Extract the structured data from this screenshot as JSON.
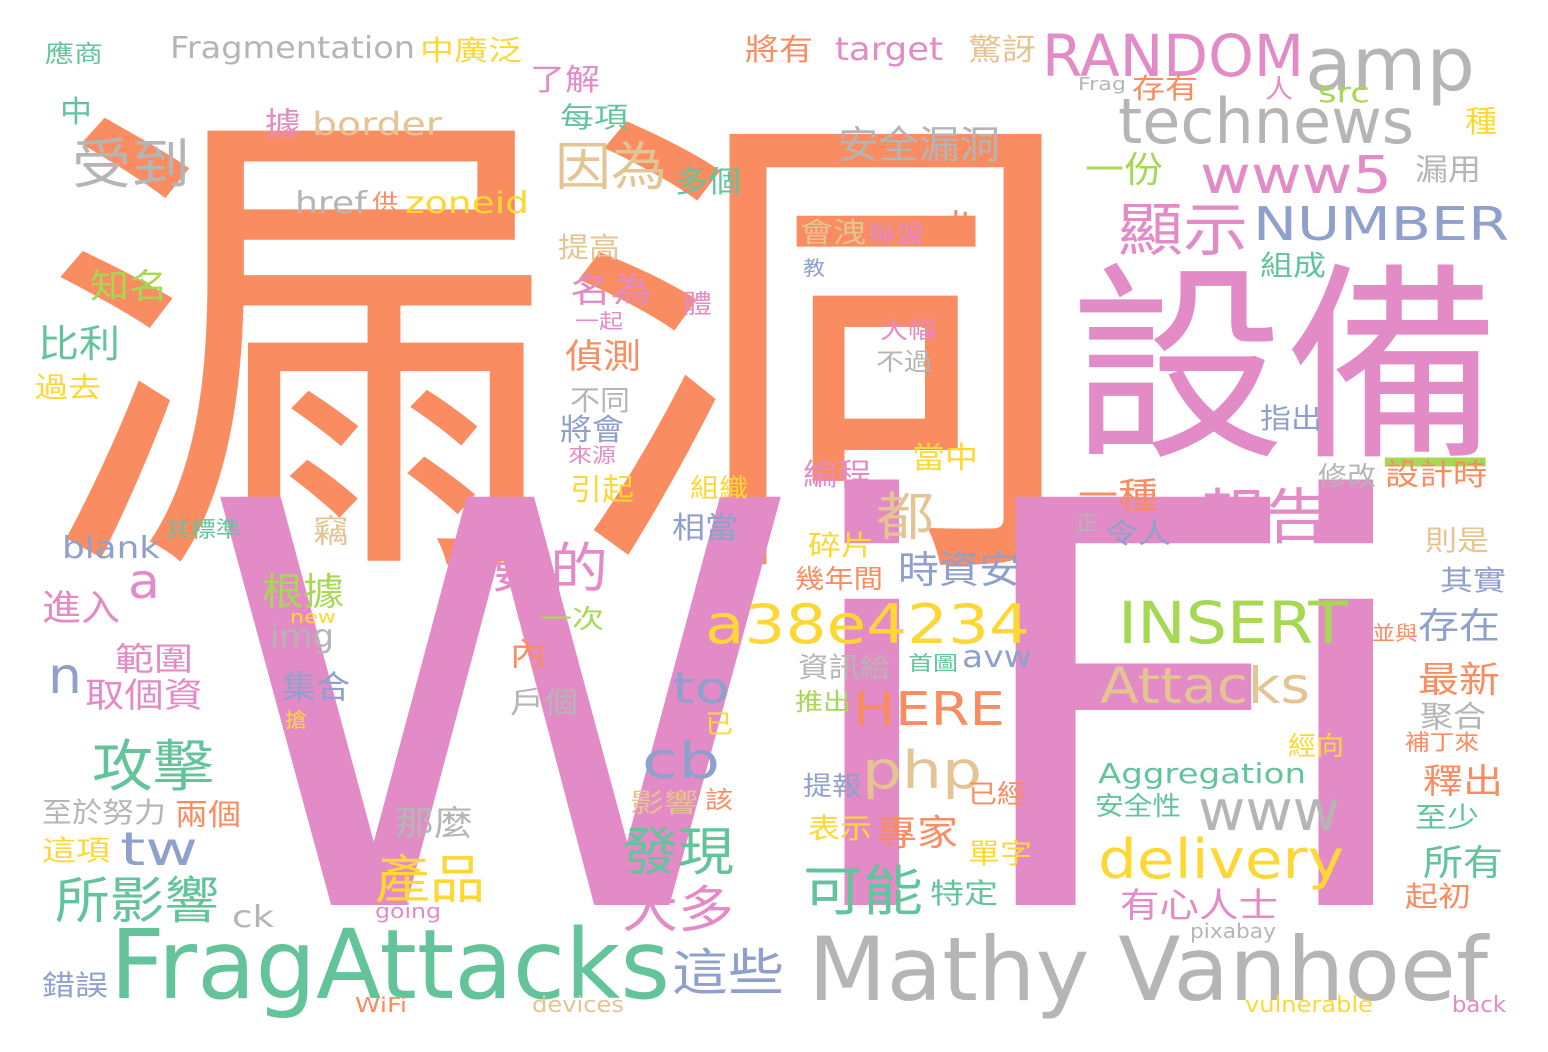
{
  "colors": {
    "background": "#ffffff",
    "orange": "#f98c60",
    "pink": "#e38bc6",
    "green": "#63c49c",
    "gray": "#b5b5b5",
    "blue": "#8ea0cb",
    "yellow": "#fdd835",
    "lime": "#a6d854",
    "tan": "#e5c494"
  },
  "words": [
    {
      "text": "漏洞",
      "color": "orange"
    },
    {
      "text": "WiFi",
      "color": "pink"
    },
    {
      "text": "設備",
      "color": "pink"
    },
    {
      "text": "FragAttacks",
      "color": "green"
    },
    {
      "text": "Mathy Vanhoef",
      "color": "gray"
    },
    {
      "text": "amp",
      "color": "gray"
    },
    {
      "text": "RANDOM",
      "color": "pink"
    },
    {
      "text": "technews",
      "color": "gray"
    },
    {
      "text": "www5",
      "color": "pink"
    },
    {
      "text": "NUMBER",
      "color": "blue"
    },
    {
      "text": "INSERT",
      "color": "lime"
    },
    {
      "text": "Attacks",
      "color": "tan"
    },
    {
      "text": "a38e4234",
      "color": "yellow"
    },
    {
      "text": "delivery",
      "color": "yellow"
    },
    {
      "text": "www",
      "color": "gray"
    },
    {
      "text": "php",
      "color": "tan"
    },
    {
      "text": "HERE",
      "color": "orange"
    },
    {
      "text": "cb",
      "color": "blue"
    },
    {
      "text": "to",
      "color": "blue"
    },
    {
      "text": "tw",
      "color": "blue"
    },
    {
      "text": "n",
      "color": "blue"
    },
    {
      "text": "a",
      "color": "pink"
    },
    {
      "text": "一",
      "color": "lime"
    },
    {
      "text": "報告",
      "color": "pink"
    },
    {
      "text": "顯示",
      "color": "pink"
    },
    {
      "text": "因為",
      "color": "tan"
    },
    {
      "text": "受到",
      "color": "gray"
    },
    {
      "text": "都",
      "color": "tan"
    },
    {
      "text": "數的",
      "color": "pink"
    },
    {
      "text": "攻擊",
      "color": "green"
    },
    {
      "text": "所影響",
      "color": "green"
    },
    {
      "text": "產品",
      "color": "yellow"
    },
    {
      "text": "發現",
      "color": "green"
    },
    {
      "text": "大多",
      "color": "pink"
    },
    {
      "text": "可能",
      "color": "green"
    },
    {
      "text": "這些",
      "color": "blue"
    },
    {
      "text": "專家",
      "color": "orange"
    },
    {
      "text": "時資安",
      "color": "blue"
    },
    {
      "text": "安全漏洞",
      "color": "gray"
    },
    {
      "text": "一份",
      "color": "lime"
    },
    {
      "text": "一種",
      "color": "orange"
    },
    {
      "text": "存在",
      "color": "blue"
    },
    {
      "text": "最新",
      "color": "orange"
    },
    {
      "text": "釋出",
      "color": "orange"
    },
    {
      "text": "所有",
      "color": "green"
    },
    {
      "text": "有心人士",
      "color": "pink"
    },
    {
      "text": "Aggregation",
      "color": "green"
    },
    {
      "text": "Fragmentation",
      "color": "gray"
    },
    {
      "text": "中廣泛",
      "color": "yellow"
    },
    {
      "text": "了解",
      "color": "pink"
    },
    {
      "text": "將有",
      "color": "orange"
    },
    {
      "text": "target",
      "color": "pink"
    },
    {
      "text": "驚訝",
      "color": "tan"
    },
    {
      "text": "Frag",
      "color": "gray"
    },
    {
      "text": "存有",
      "color": "orange"
    },
    {
      "text": "人",
      "color": "pink"
    },
    {
      "text": "src",
      "color": "lime"
    },
    {
      "text": "種",
      "color": "yellow"
    },
    {
      "text": "漏用",
      "color": "gray"
    },
    {
      "text": "應商",
      "color": "green"
    },
    {
      "text": "中",
      "color": "green"
    },
    {
      "text": "據",
      "color": "pink"
    },
    {
      "text": "border",
      "color": "tan"
    },
    {
      "text": "每項",
      "color": "green"
    },
    {
      "text": "多個",
      "color": "green"
    },
    {
      "text": "href",
      "color": "gray"
    },
    {
      "text": "供",
      "color": "orange"
    },
    {
      "text": "zoneid",
      "color": "yellow"
    },
    {
      "text": "知名",
      "color": "lime"
    },
    {
      "text": "比利",
      "color": "green"
    },
    {
      "text": "過去",
      "color": "yellow"
    },
    {
      "text": "提高",
      "color": "tan"
    },
    {
      "text": "會洩",
      "color": "tan"
    },
    {
      "text": "聯盟",
      "color": "pink"
    },
    {
      "text": "alt",
      "color": "orange"
    },
    {
      "text": "組成",
      "color": "green"
    },
    {
      "text": "教",
      "color": "blue"
    },
    {
      "text": "體",
      "color": "pink"
    },
    {
      "text": "一起",
      "color": "pink"
    },
    {
      "text": "大幅",
      "color": "pink"
    },
    {
      "text": "不過",
      "color": "gray"
    },
    {
      "text": "名為",
      "color": "pink"
    },
    {
      "text": "偵測",
      "color": "orange"
    },
    {
      "text": "不同",
      "color": "gray"
    },
    {
      "text": "將會",
      "color": "blue"
    },
    {
      "text": "來源",
      "color": "pink"
    },
    {
      "text": "引起",
      "color": "yellow"
    },
    {
      "text": "組織",
      "color": "yellow"
    },
    {
      "text": "編程",
      "color": "pink"
    },
    {
      "text": "當中",
      "color": "yellow"
    },
    {
      "text": "指出",
      "color": "blue"
    },
    {
      "text": "修改",
      "color": "gray"
    },
    {
      "text": "設計時",
      "color": "orange"
    },
    {
      "text": "正",
      "color": "gray"
    },
    {
      "text": "令人",
      "color": "blue"
    },
    {
      "text": "則是",
      "color": "tan"
    },
    {
      "text": "其實",
      "color": "blue"
    },
    {
      "text": "並與",
      "color": "orange"
    },
    {
      "text": "其標準",
      "color": "green"
    },
    {
      "text": "blank",
      "color": "blue"
    },
    {
      "text": "竊",
      "color": "tan"
    },
    {
      "text": "相當",
      "color": "blue"
    },
    {
      "text": "碎片",
      "color": "yellow"
    },
    {
      "text": "幾年間",
      "color": "orange"
    },
    {
      "text": "進入",
      "color": "pink"
    },
    {
      "text": "根據",
      "color": "lime"
    },
    {
      "text": "img",
      "color": "gray"
    },
    {
      "text": "new",
      "color": "yellow"
    },
    {
      "text": "一次",
      "color": "lime"
    },
    {
      "text": "範圍",
      "color": "pink"
    },
    {
      "text": "取個資",
      "color": "pink"
    },
    {
      "text": "內",
      "color": "orange"
    },
    {
      "text": "集合",
      "color": "blue"
    },
    {
      "text": "資訊給",
      "color": "gray"
    },
    {
      "text": "首圖",
      "color": "green"
    },
    {
      "text": "avw",
      "color": "blue"
    },
    {
      "text": "戶個",
      "color": "gray"
    },
    {
      "text": "搶",
      "color": "yellow"
    },
    {
      "text": "推出",
      "color": "lime"
    },
    {
      "text": "已",
      "color": "yellow"
    },
    {
      "text": "聚合",
      "color": "gray"
    },
    {
      "text": "經向",
      "color": "yellow"
    },
    {
      "text": "補丁來",
      "color": "orange"
    },
    {
      "text": "至於",
      "color": "gray"
    },
    {
      "text": "努力",
      "color": "gray"
    },
    {
      "text": "兩個",
      "color": "orange"
    },
    {
      "text": "這項",
      "color": "yellow"
    },
    {
      "text": "那麼",
      "color": "gray"
    },
    {
      "text": "影響",
      "color": "tan"
    },
    {
      "text": "該",
      "color": "orange"
    },
    {
      "text": "提報",
      "color": "blue"
    },
    {
      "text": "已經",
      "color": "orange"
    },
    {
      "text": "安全性",
      "color": "green"
    },
    {
      "text": "至少",
      "color": "green"
    },
    {
      "text": "表示",
      "color": "yellow"
    },
    {
      "text": "單字",
      "color": "yellow"
    },
    {
      "text": "ck",
      "color": "gray"
    },
    {
      "text": "特定",
      "color": "green"
    },
    {
      "text": "起初",
      "color": "orange"
    },
    {
      "text": "going",
      "color": "pink"
    },
    {
      "text": "pixabay",
      "color": "gray"
    },
    {
      "text": "錯誤",
      "color": "blue"
    },
    {
      "text": "WiFi",
      "color": "orange"
    },
    {
      "text": "devices",
      "color": "tan"
    },
    {
      "text": "vulnerable",
      "color": "yellow"
    },
    {
      "text": "back",
      "color": "pink"
    }
  ]
}
